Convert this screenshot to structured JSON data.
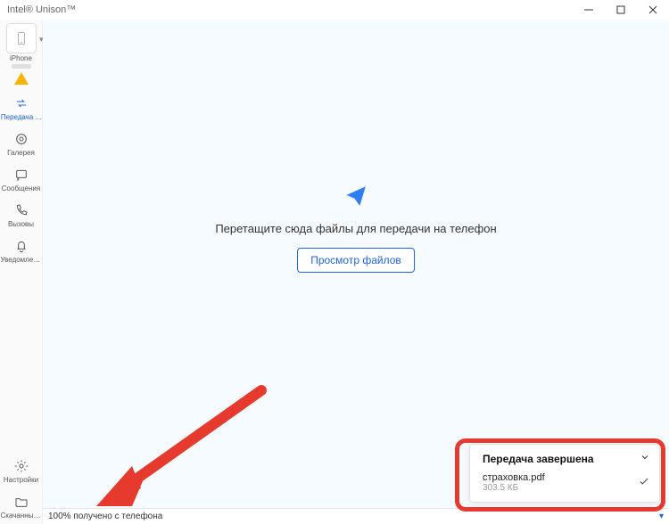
{
  "window": {
    "title": "Intel® Unison™"
  },
  "device": {
    "name": "iPhone"
  },
  "sidebar": {
    "items": [
      {
        "label": "Передача ...",
        "icon": "transfer"
      },
      {
        "label": "Галерея",
        "icon": "gallery"
      },
      {
        "label": "Сообщения",
        "icon": "messages"
      },
      {
        "label": "Вызовы",
        "icon": "calls"
      },
      {
        "label": "Уведомлен...",
        "icon": "notifications"
      }
    ],
    "bottom": [
      {
        "label": "Настройки",
        "icon": "settings"
      },
      {
        "label": "Скачанные...",
        "icon": "downloads"
      }
    ]
  },
  "main": {
    "drop_text": "Перетащите сюда файлы для передачи на телефон",
    "browse_label": "Просмотр файлов"
  },
  "status": {
    "text": "100% получено с телефона"
  },
  "toast": {
    "title": "Передача завершена",
    "file_name": "страховка.pdf",
    "file_size": "303.5 КБ"
  }
}
